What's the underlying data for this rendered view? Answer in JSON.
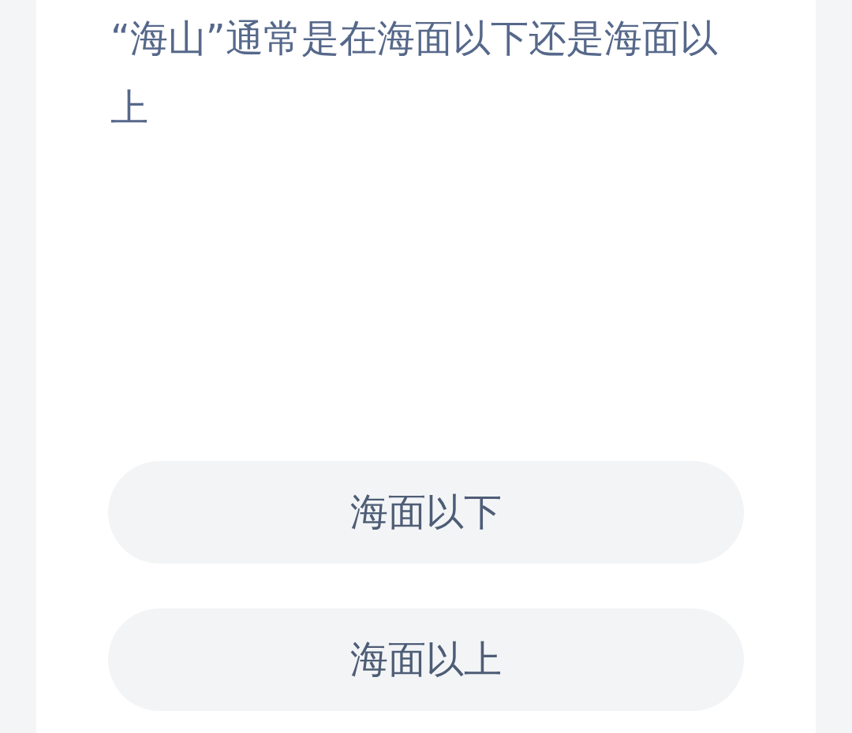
{
  "question": "“海山”通常是在海面以下还是海面以上",
  "options": [
    {
      "label": "海面以下"
    },
    {
      "label": "海面以上"
    }
  ]
}
